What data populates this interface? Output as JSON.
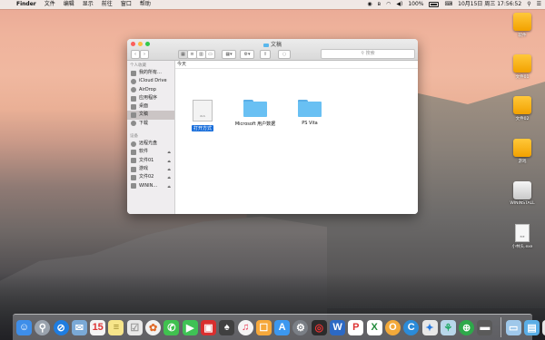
{
  "menubar": {
    "app": "Finder",
    "items": [
      "文件",
      "编辑",
      "显示",
      "前往",
      "窗口",
      "帮助"
    ],
    "battery": "100%",
    "datetime": "10月15日 周三 17:56:52"
  },
  "finder": {
    "title": "文稿",
    "search_placeholder": "搜索",
    "breadcrumb": "今天",
    "sidebar": {
      "favorites_header": "个人收藏",
      "favorites": [
        "我的所有…",
        "iCloud Drive",
        "AirDrop",
        "应用程序",
        "桌面",
        "文稿",
        "下载"
      ],
      "devices_header": "设备",
      "devices": [
        "远程光盘",
        "软件",
        "文件01",
        "游戏",
        "文件02",
        "WININ…"
      ]
    },
    "files": [
      {
        "name": "打开方式",
        "ext": "XLS",
        "kind": "document"
      },
      {
        "name": "Microsoft 用户数据",
        "kind": "folder"
      },
      {
        "name": "PS Vita",
        "kind": "folder"
      }
    ]
  },
  "desktop_icons": [
    "软件",
    "文件01",
    "文件02",
    "游戏",
    "WININSTALL",
    "小林头.exe"
  ],
  "colors": {
    "folder": "#69c0f3",
    "selection": "#1a6fdb",
    "drive": "#f2a100"
  }
}
